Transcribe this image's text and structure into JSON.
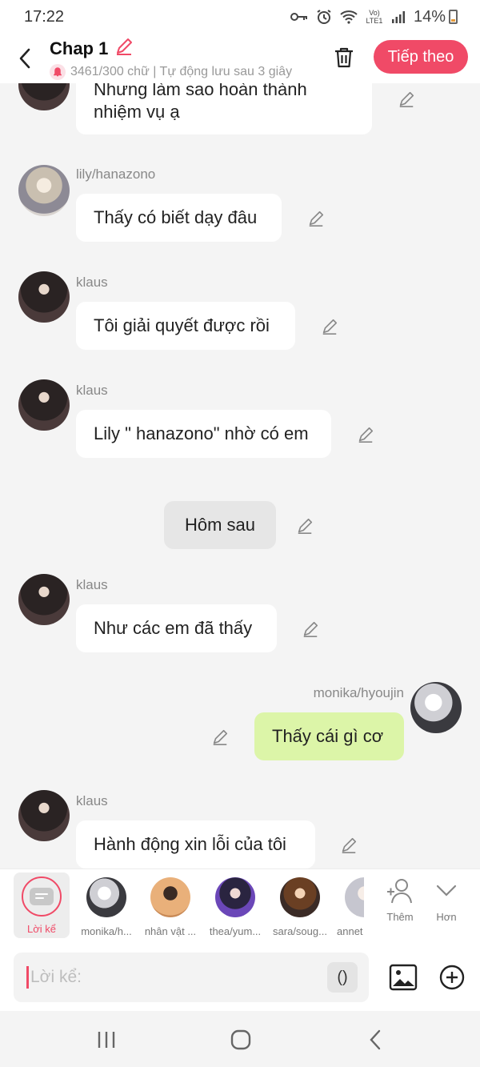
{
  "status_bar": {
    "time": "17:22",
    "battery": "14%",
    "network": "Vo) LTE1"
  },
  "header": {
    "title": "Chap 1",
    "subtitle": "3461/300 chữ | Tự động lưu sau 3 giây",
    "next_label": "Tiếp theo"
  },
  "messages": [
    {
      "kind": "other",
      "speaker": "",
      "text": "Nhưng làm sao hoàn thành nhiệm vụ ạ"
    },
    {
      "kind": "other",
      "speaker": "lily/hanazono",
      "text": "Thấy có biết dạy đâu",
      "avatar": "avatar-lily"
    },
    {
      "kind": "other",
      "speaker": "klaus",
      "text": "Tôi giải quyết được rồi",
      "avatar": "avatar-klaus"
    },
    {
      "kind": "other",
      "speaker": "klaus",
      "text": "Lily \" hanazono\" nhờ có em",
      "avatar": "avatar-klaus"
    },
    {
      "kind": "narration",
      "speaker": "",
      "text": "Hôm sau"
    },
    {
      "kind": "other",
      "speaker": "klaus",
      "text": "Như các em đã thấy",
      "avatar": "avatar-klaus"
    },
    {
      "kind": "mine",
      "speaker": "monika/hyoujin",
      "text": "Thấy cái gì cơ",
      "avatar": "avatar-monika"
    },
    {
      "kind": "other",
      "speaker": "klaus",
      "text": "Hành động xin lỗi của tôi",
      "avatar": "avatar-klaus"
    }
  ],
  "characters": {
    "narration_label": "Lời kể",
    "items": [
      "monika/h...",
      "nhân vật ...",
      "thea/yum...",
      "sara/soug...",
      "annet"
    ],
    "add_label": "Thêm",
    "more_label": "Hơn"
  },
  "input": {
    "placeholder": "Lời kể:",
    "paren_label": "()"
  },
  "colors": {
    "accent": "#f04a67",
    "my_bubble": "#dcf5a8",
    "narration_bubble": "#e6e6e6"
  }
}
